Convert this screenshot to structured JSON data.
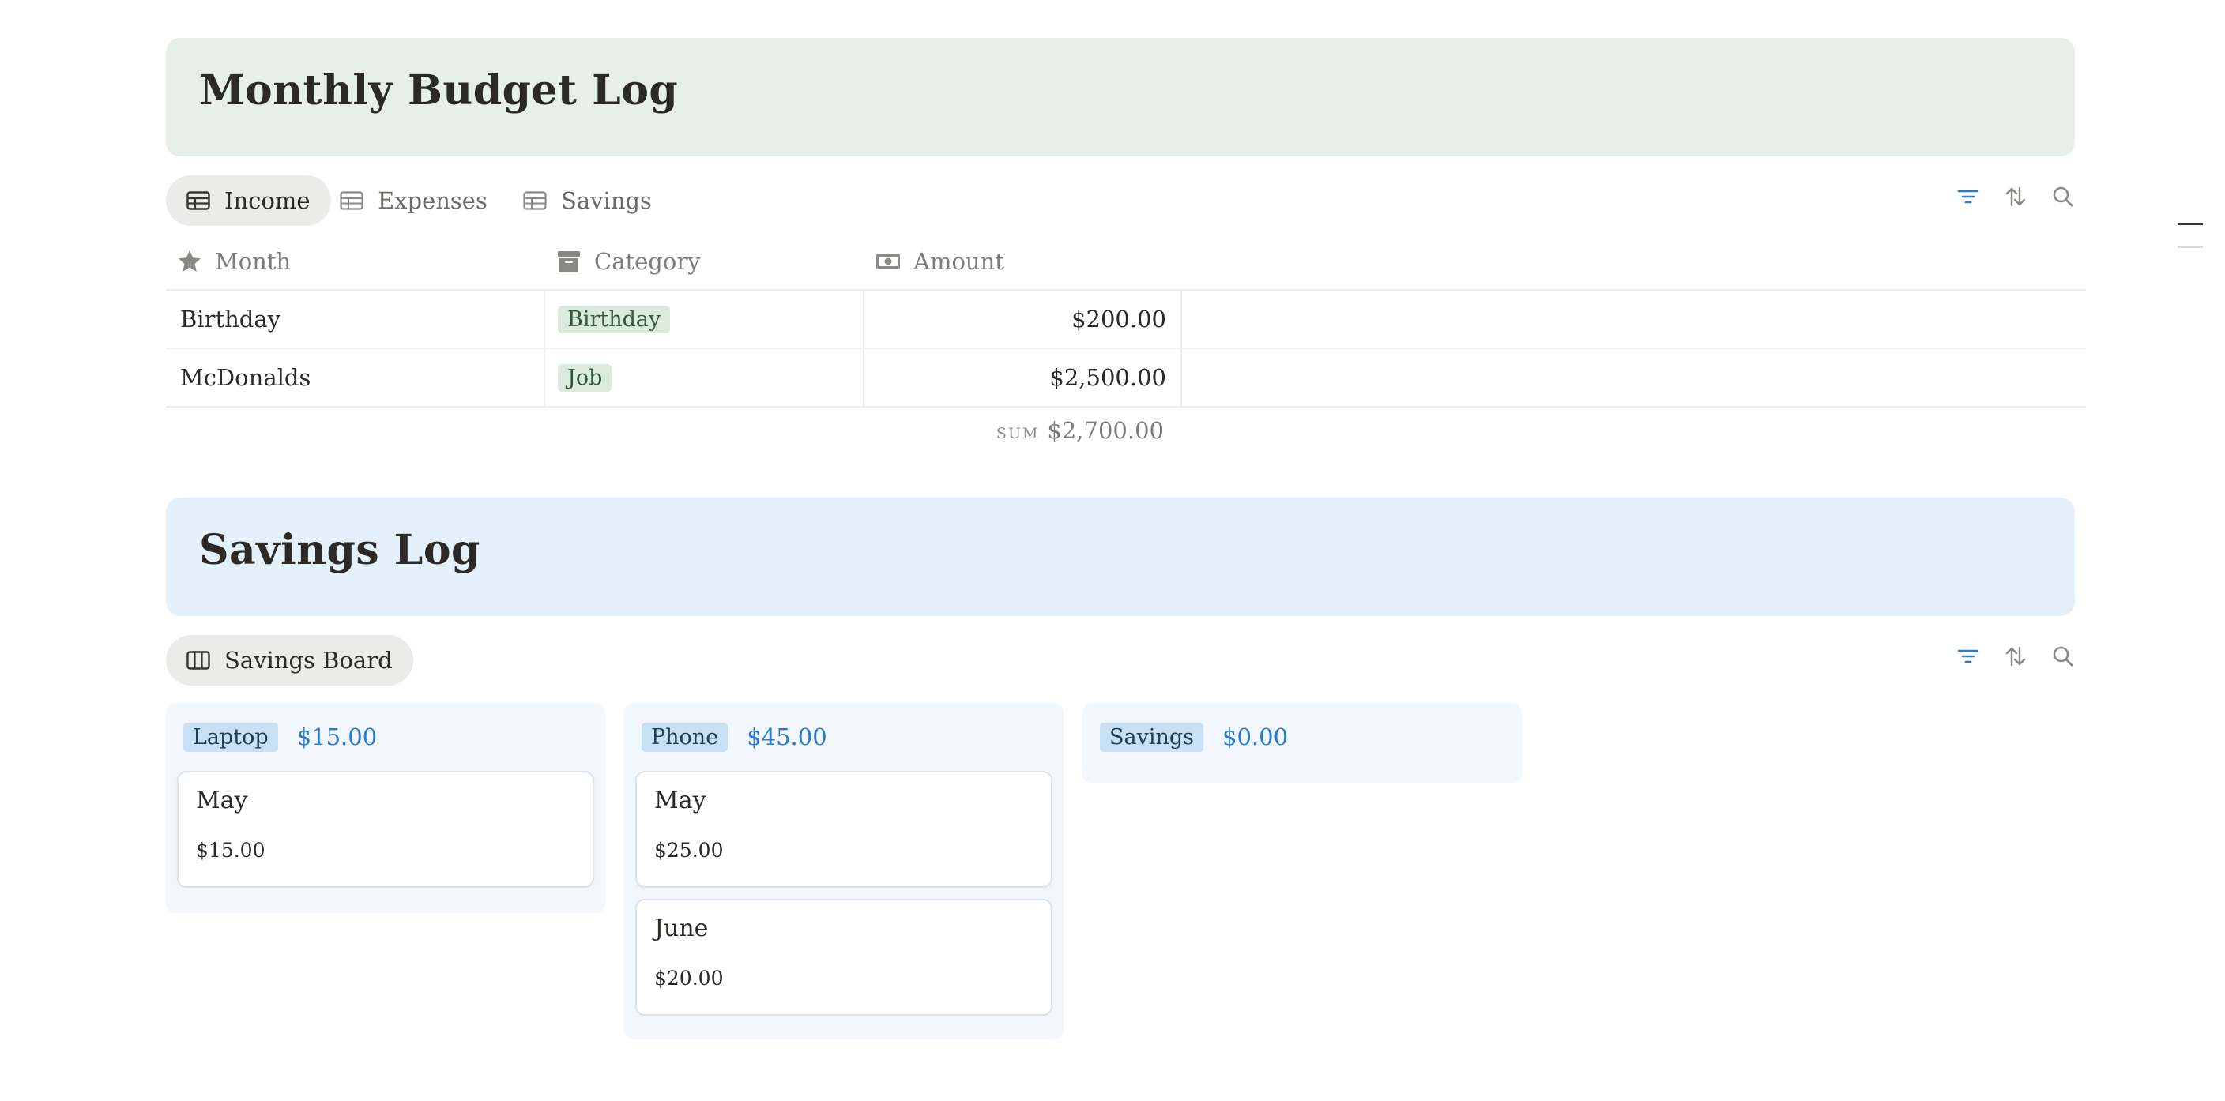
{
  "budget": {
    "title": "Monthly Budget Log",
    "tabs": [
      {
        "label": "Income",
        "active": true
      },
      {
        "label": "Expenses",
        "active": false
      },
      {
        "label": "Savings",
        "active": false
      }
    ],
    "columns": [
      "Month",
      "Category",
      "Amount"
    ],
    "rows": [
      {
        "month": "Birthday",
        "category": "Birthday",
        "amount": "$200.00"
      },
      {
        "month": "McDonalds",
        "category": "Job",
        "amount": "$2,500.00"
      }
    ],
    "sum_label": "SUM",
    "sum_value": "$2,700.00"
  },
  "savings": {
    "title": "Savings Log",
    "view_tab": "Savings Board",
    "groups": [
      {
        "tag": "Laptop",
        "total": "$15.00",
        "cards": [
          {
            "title": "May",
            "amount": "$15.00"
          }
        ]
      },
      {
        "tag": "Phone",
        "total": "$45.00",
        "cards": [
          {
            "title": "May",
            "amount": "$25.00"
          },
          {
            "title": "June",
            "amount": "$20.00"
          }
        ]
      },
      {
        "tag": "Savings",
        "total": "$0.00",
        "cards": []
      }
    ]
  },
  "icons": {
    "tab": "table-icon",
    "board": "board-icon",
    "filter": "filter-icon",
    "sort": "sort-icon",
    "search": "search-icon",
    "month": "star-icon",
    "category": "archive-icon",
    "amount": "money-icon"
  },
  "colors": {
    "budget_banner": "#e6efe8",
    "savings_banner": "#e4f0fa",
    "accent_blue": "#2a7bd0",
    "income_tag": "#dbeadd",
    "savings_tag": "#c8e0f4"
  }
}
